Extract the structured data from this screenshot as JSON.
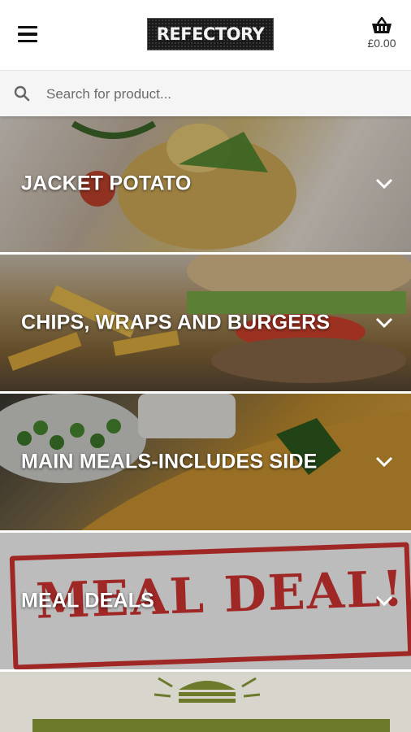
{
  "header": {
    "logo_text": "REFECTORY",
    "cart_total": "£0.00"
  },
  "search": {
    "placeholder": "Search for product..."
  },
  "categories": [
    {
      "label": "JACKET POTATO"
    },
    {
      "label": "CHIPS, WRAPS AND BURGERS"
    },
    {
      "label": "MAIN MEALS-INCLUDES SIDE"
    },
    {
      "label": "MEAL DEALS"
    }
  ],
  "images": {
    "meal_deal_text": "MEAL DEAL!"
  },
  "colors": {
    "header_bg": "#ffffff",
    "search_bg": "#f5f5f5",
    "label_color": "#ffffff",
    "meal_deal_red": "#c3312f"
  }
}
